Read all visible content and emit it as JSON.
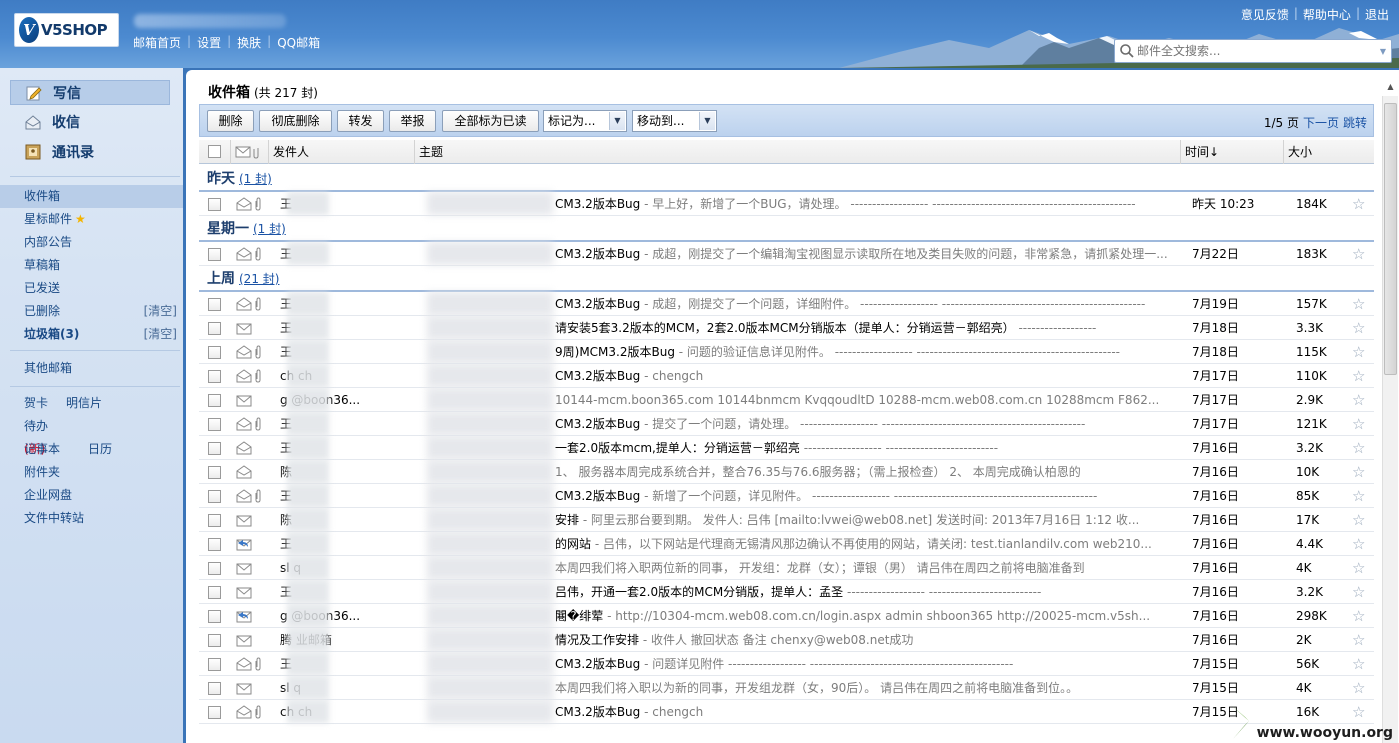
{
  "brand": {
    "logo_text": "V5SHOP"
  },
  "topnav": [
    "邮箱首页",
    "设置",
    "换肤",
    "QQ邮箱"
  ],
  "toplinks": [
    "意见反馈",
    "帮助中心",
    "退出"
  ],
  "search": {
    "placeholder": "邮件全文搜索..."
  },
  "sidebar": {
    "write": "写信",
    "receive": "收信",
    "contacts": "通讯录",
    "folders": [
      {
        "label": "收件箱"
      },
      {
        "label": "星标邮件"
      },
      {
        "label": "内部公告"
      },
      {
        "label": "草稿箱"
      },
      {
        "label": "已发送"
      },
      {
        "label": "已删除",
        "action": "[清空]"
      },
      {
        "label": "垃圾箱(3)",
        "action": "[清空]"
      }
    ],
    "other_mailbox": "其他邮箱",
    "tools": {
      "card": "贺卡",
      "postcard": "明信片",
      "todo": "待办",
      "todo_new": "(新)",
      "calendar": "日历",
      "notes": "记事本",
      "attachments": "附件夹",
      "netdisk": "企业网盘",
      "transfer": "文件中转站"
    }
  },
  "main": {
    "title": "收件箱",
    "count": "(共 217 封)",
    "toolbar": {
      "delete": "删除",
      "delete_forever": "彻底删除",
      "forward": "转发",
      "report": "举报",
      "mark_all_read": "全部标为已读",
      "mark_as": "标记为...",
      "move_to": "移动到..."
    },
    "pager": {
      "page": "1/5 页",
      "next": "下一页",
      "jump": "跳转"
    },
    "columns": {
      "sender": "发件人",
      "subject": "主题",
      "time": "时间↓",
      "size": "大小"
    },
    "groups": [
      {
        "title": "昨天",
        "count": "(1 封)",
        "rows": [
          {
            "sender": "王",
            "subject": "CM3.2版本Bug",
            "preview": " - 早上好，新增了一个BUG，请处理。 ------------------ -----------------------------------------------",
            "time": "昨天 10:23",
            "size": "184K",
            "env": "open",
            "clip": true
          }
        ]
      },
      {
        "title": "星期一",
        "count": "(1 封)",
        "rows": [
          {
            "sender": "王",
            "subject": "CM3.2版本Bug",
            "preview": " - 成超，刚提交了一个编辑淘宝视图显示读取所在地及类目失败的问题，非常紧急，请抓紧处理一...",
            "time": "7月22日",
            "size": "183K",
            "env": "open",
            "clip": true
          }
        ]
      },
      {
        "title": "上周",
        "count": "(21 封)",
        "rows": [
          {
            "sender": "王",
            "subject": "CM3.2版本Bug",
            "preview": " - 成超，刚提交了一个问题，详细附件。 ------------------ -----------------------------------------------",
            "time": "7月19日",
            "size": "157K",
            "env": "open",
            "clip": true
          },
          {
            "sender": "王",
            "subject": "请安装5套3.2版本的MCM，2套2.0版本MCM分销版本（提单人：分销运营－郭绍亮）",
            "preview": " ------------------",
            "time": "7月18日",
            "size": "3.3K",
            "env": "closed",
            "clip": false
          },
          {
            "sender": "王",
            "subject": "9周)MCM3.2版本Bug",
            "preview": " - 问题的验证信息详见附件。 ------------------ -----------------------------------------------",
            "time": "7月18日",
            "size": "115K",
            "env": "open",
            "clip": true
          },
          {
            "sender": "ch    ch",
            "subject": "CM3.2版本Bug",
            "preview": " - chengch",
            "time": "7月17日",
            "size": "110K",
            "env": "open",
            "clip": true
          },
          {
            "sender": "g      @boon36...",
            "subject": "",
            "preview": " 10144-mcm.boon365.com 10144bnmcm KvqqoudltD  10288-mcm.web08.com.cn 10288mcm F862...",
            "time": "7月17日",
            "size": "2.9K",
            "env": "closed",
            "clip": false
          },
          {
            "sender": "王",
            "subject": "CM3.2版本Bug",
            "preview": " - 提交了一个问题，请处理。 ------------------ -----------------------------------------------",
            "time": "7月17日",
            "size": "121K",
            "env": "open",
            "clip": true
          },
          {
            "sender": "王",
            "subject": "一套2.0版本mcm,提单人：分销运营－郭绍亮",
            "preview": " ------------------ --------------------------",
            "time": "7月16日",
            "size": "3.2K",
            "env": "open",
            "clip": false
          },
          {
            "sender": "陈",
            "subject": "",
            "preview": "   1、 服务器本周完成系统合并，整合76.35与76.6服务器；（需上报检查） 2、 本周完成确认柏恩的",
            "time": "7月16日",
            "size": "10K",
            "env": "open",
            "clip": false
          },
          {
            "sender": "王",
            "subject": "CM3.2版本Bug",
            "preview": " - 新增了一个问题，详见附件。 ------------------ -----------------------------------------------",
            "time": "7月16日",
            "size": "85K",
            "env": "open",
            "clip": true
          },
          {
            "sender": "陈",
            "subject": "安排",
            "preview": " - 阿里云那台要到期。  发件人: 吕伟 [mailto:lvwei@web08.net] 发送时间: 2013年7月16日 1:12 收...",
            "time": "7月16日",
            "size": "17K",
            "env": "closed",
            "clip": false
          },
          {
            "sender": "王",
            "subject": "的网站",
            "preview": " - 吕伟，以下网站是代理商无锡清风那边确认不再使用的网站，请关闭:  test.tianlandilv.com web210...",
            "time": "7月16日",
            "size": "4.4K",
            "env": "reply",
            "clip": false
          },
          {
            "sender": "sl    q",
            "subject": "",
            "preview": "   本周四我们将入职两位新的同事， 开发组：龙群（女）；谭银（男） 请吕伟在周四之前将电脑准备到",
            "time": "7月16日",
            "size": "4K",
            "env": "closed",
            "clip": false
          },
          {
            "sender": "王",
            "subject": "吕伟，开通一套2.0版本的MCM分销版，提单人：孟圣",
            "preview": " ------------------ --------------------------",
            "time": "7月16日",
            "size": "3.2K",
            "env": "closed",
            "clip": false
          },
          {
            "sender": "g      @boon36...",
            "subject": "闀�绯荤",
            "preview": " - http://10304-mcm.web08.com.cn/login.aspx admin shboon365 http://20025-mcm.v5sh...",
            "time": "7月16日",
            "size": "298K",
            "env": "reply",
            "clip": false
          },
          {
            "sender": "腾    业邮箱",
            "subject": "情况及工作安排",
            "preview": " - 收件人 撤回状态 备注 chenxy@web08.net成功",
            "time": "7月16日",
            "size": "2K",
            "env": "closed",
            "clip": false
          },
          {
            "sender": "王",
            "subject": "CM3.2版本Bug",
            "preview": " - 问题详见附件 ------------------ -----------------------------------------------",
            "time": "7月15日",
            "size": "56K",
            "env": "open",
            "clip": true
          },
          {
            "sender": "sl    q",
            "subject": "",
            "preview": "   本周四我们将入职以为新的同事，开发组龙群（女，90后）。 请吕伟在周四之前将电脑准备到位。。",
            "time": "7月15日",
            "size": "4K",
            "env": "closed",
            "clip": false
          },
          {
            "sender": "ch    ch",
            "subject": "CM3.2版本Bug",
            "preview": " - chengch",
            "time": "7月15日",
            "size": "16K",
            "env": "open",
            "clip": true
          }
        ]
      }
    ]
  },
  "watermark": "www.wooyun.org",
  "colors": {
    "topbar": "#3f7cc4",
    "sidebar": "#d6e3f3",
    "link": "#1b53a5",
    "group_header": "#1d3e6d"
  }
}
